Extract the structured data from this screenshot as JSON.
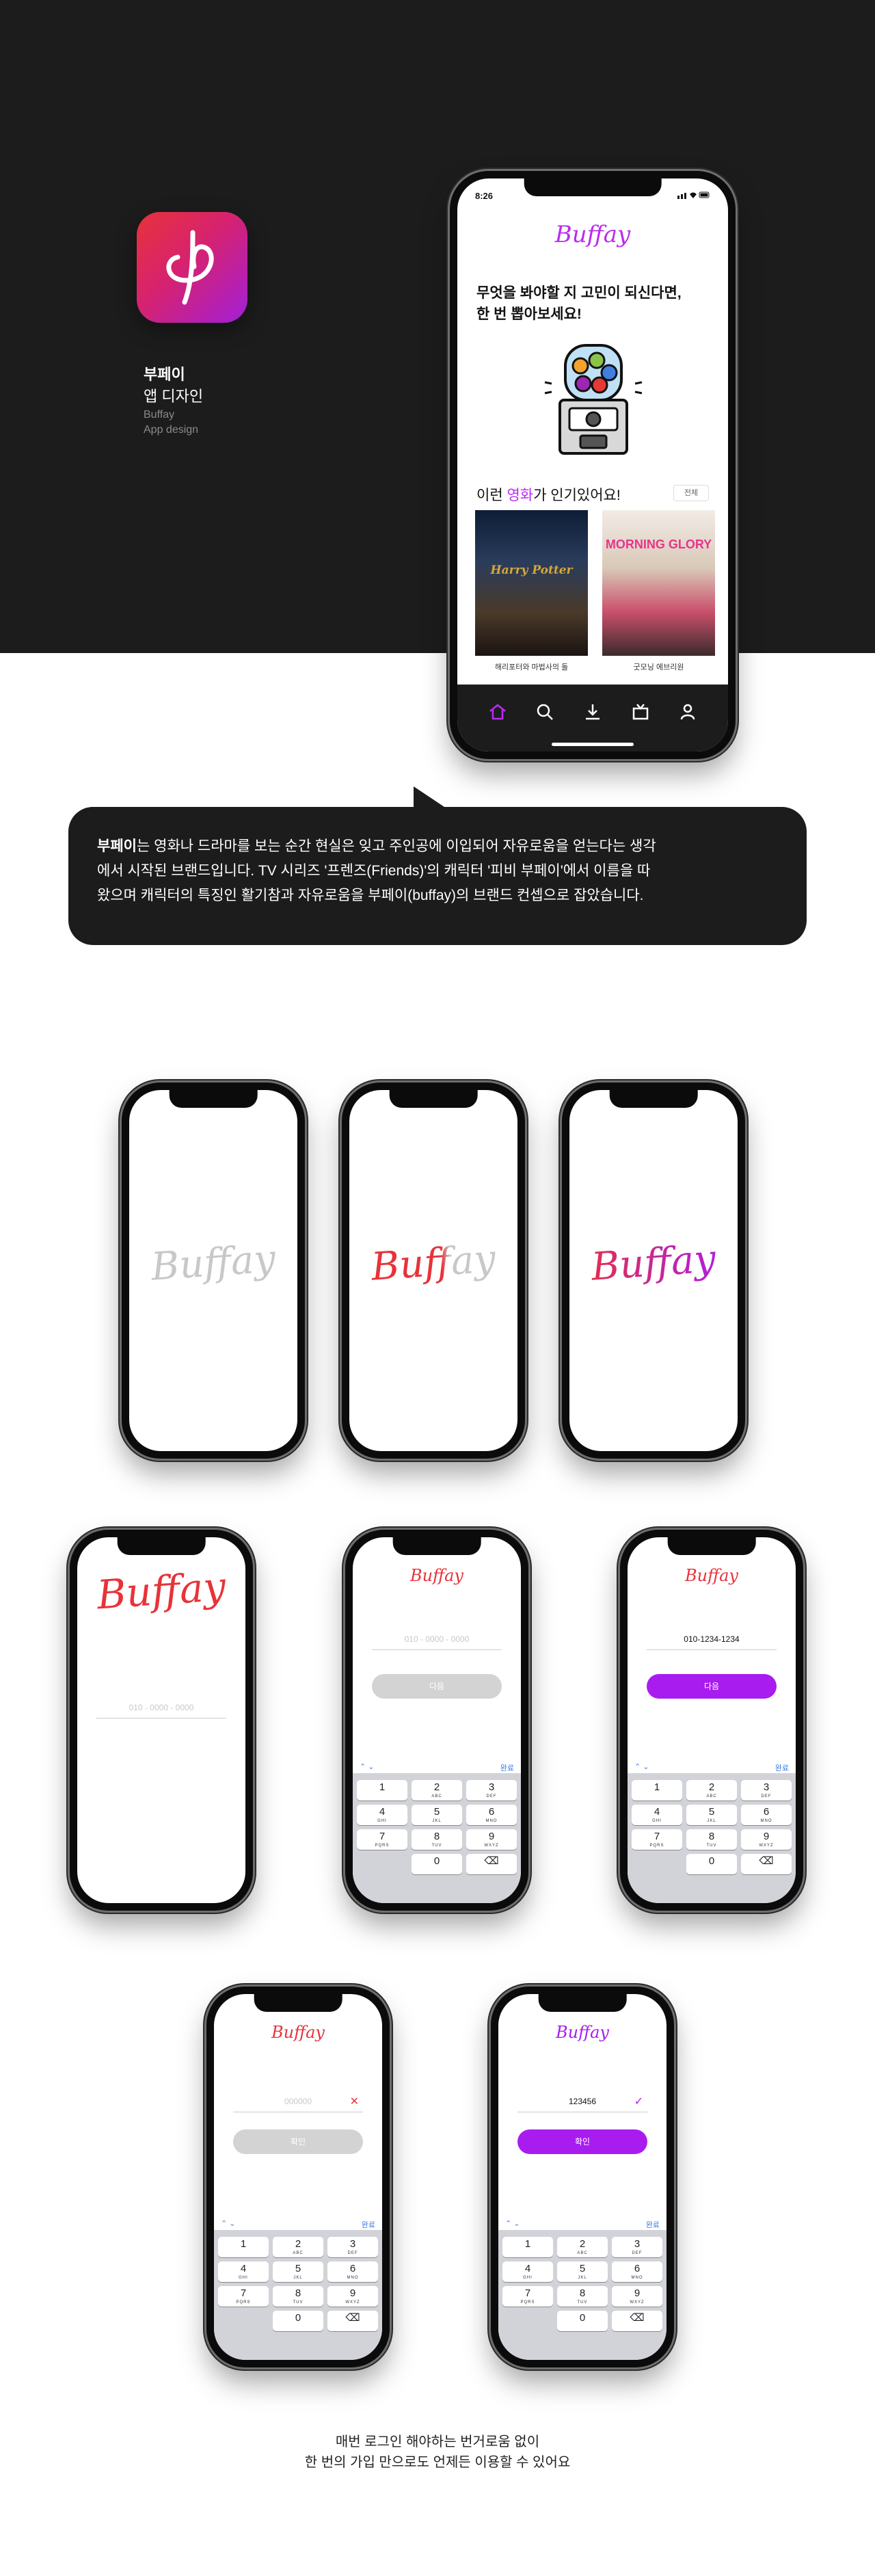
{
  "hero": {
    "app_title": "부페이",
    "app_subtitle": "앱 디자인",
    "app_name_en": "Buffay",
    "app_design_en": "App design",
    "icon_glyph": "φ",
    "icon_gradient": [
      "#e8323a",
      "#d62270",
      "#a21fd8"
    ]
  },
  "main_phone": {
    "time": "8:26",
    "logo": "Buffay",
    "headline_1": "무엇을 봐야할 지 고민이 되신다면,",
    "headline_2": "한 번 뽑아보세요!",
    "popular_prefix": "이런 ",
    "popular_highlight": "영화",
    "popular_suffix": "가 인기있어요!",
    "more_label": "전체",
    "posters": [
      {
        "title": "Harry Potter",
        "caption": "해리포터와 마법사의 돌"
      },
      {
        "title": "MORNING GLORY",
        "caption": "굿모닝 에브리원"
      }
    ],
    "tabs": [
      "home-icon",
      "search-icon",
      "download-icon",
      "tv-icon",
      "user-icon"
    ],
    "accent": "#b92cf0"
  },
  "bubble": {
    "brand": "부페이",
    "line1_rest": "는 영화나 드라마를 보는 순간 현실은 잊고 주인공에 이입되어 자유로움을 얻는다는 생각",
    "line2": "에서 시작된 브랜드입니다. TV 시리즈 '프렌즈(Friends)'의 캐릭터 '피비 부페이'에서 이름을 따",
    "line3": "왔으며 캐릭터의 특징인 활기참과 자유로움을 부페이(buffay)의 브랜드 컨셉으로 잡았습니다."
  },
  "splash": {
    "logo": "Buffay",
    "colors": [
      "#c8c8c8",
      "#e8323a",
      "#a91cf0"
    ]
  },
  "login": {
    "phone_placeholder": "010 - 0000 - 0000",
    "phone_value": "010-1234-1234",
    "next_label": "다음",
    "code_placeholder": "000000",
    "code_value": "123456",
    "confirm_label": "확인",
    "kb_done": "완료",
    "keys": [
      {
        "n": "1",
        "s": ""
      },
      {
        "n": "2",
        "s": "ABC"
      },
      {
        "n": "3",
        "s": "DEF"
      },
      {
        "n": "4",
        "s": "GHI"
      },
      {
        "n": "5",
        "s": "JKL"
      },
      {
        "n": "6",
        "s": "MNO"
      },
      {
        "n": "7",
        "s": "PQRS"
      },
      {
        "n": "8",
        "s": "TUV"
      },
      {
        "n": "9",
        "s": "WXYZ"
      },
      {
        "n": "",
        "s": ""
      },
      {
        "n": "0",
        "s": ""
      },
      {
        "n": "⌫",
        "s": ""
      }
    ]
  },
  "footer": {
    "line1": "매번 로그인 해야하는 번거로움 없이",
    "line2": "한 번의 가입 만으로도 언제든 이용할 수 있어요"
  }
}
